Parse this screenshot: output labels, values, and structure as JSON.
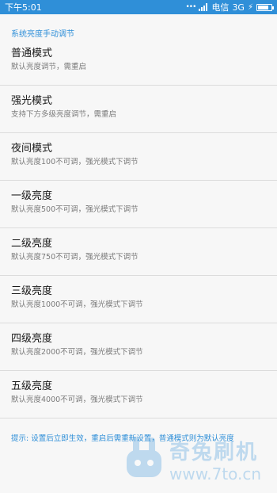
{
  "status_bar": {
    "time": "下午5:01",
    "carrier": "电信",
    "network": "3G",
    "accent_color": "#2f8fd8"
  },
  "section_title": "系统亮度手动调节",
  "items": [
    {
      "title": "普通模式",
      "subtitle": "默认亮度调节，需重启"
    },
    {
      "title": "强光模式",
      "subtitle": "支持下方多级亮度调节，需重启"
    },
    {
      "title": "夜间模式",
      "subtitle": "默认亮度100不可调，强光模式下调节"
    },
    {
      "title": "一级亮度",
      "subtitle": "默认亮度500不可调，强光模式下调节"
    },
    {
      "title": "二级亮度",
      "subtitle": "默认亮度750不可调，强光模式下调节"
    },
    {
      "title": "三级亮度",
      "subtitle": "默认亮度1000不可调，强光模式下调节"
    },
    {
      "title": "四级亮度",
      "subtitle": "默认亮度2000不可调，强光模式下调节"
    },
    {
      "title": "五级亮度",
      "subtitle": "默认亮度4000不可调，强光模式下调节"
    }
  ],
  "hint": "提示: 设置后立即生效，重启后需重新设置，普通模式则为默认亮度",
  "watermark": {
    "name": "奇兔刷机",
    "url": "www.7to.cn"
  }
}
